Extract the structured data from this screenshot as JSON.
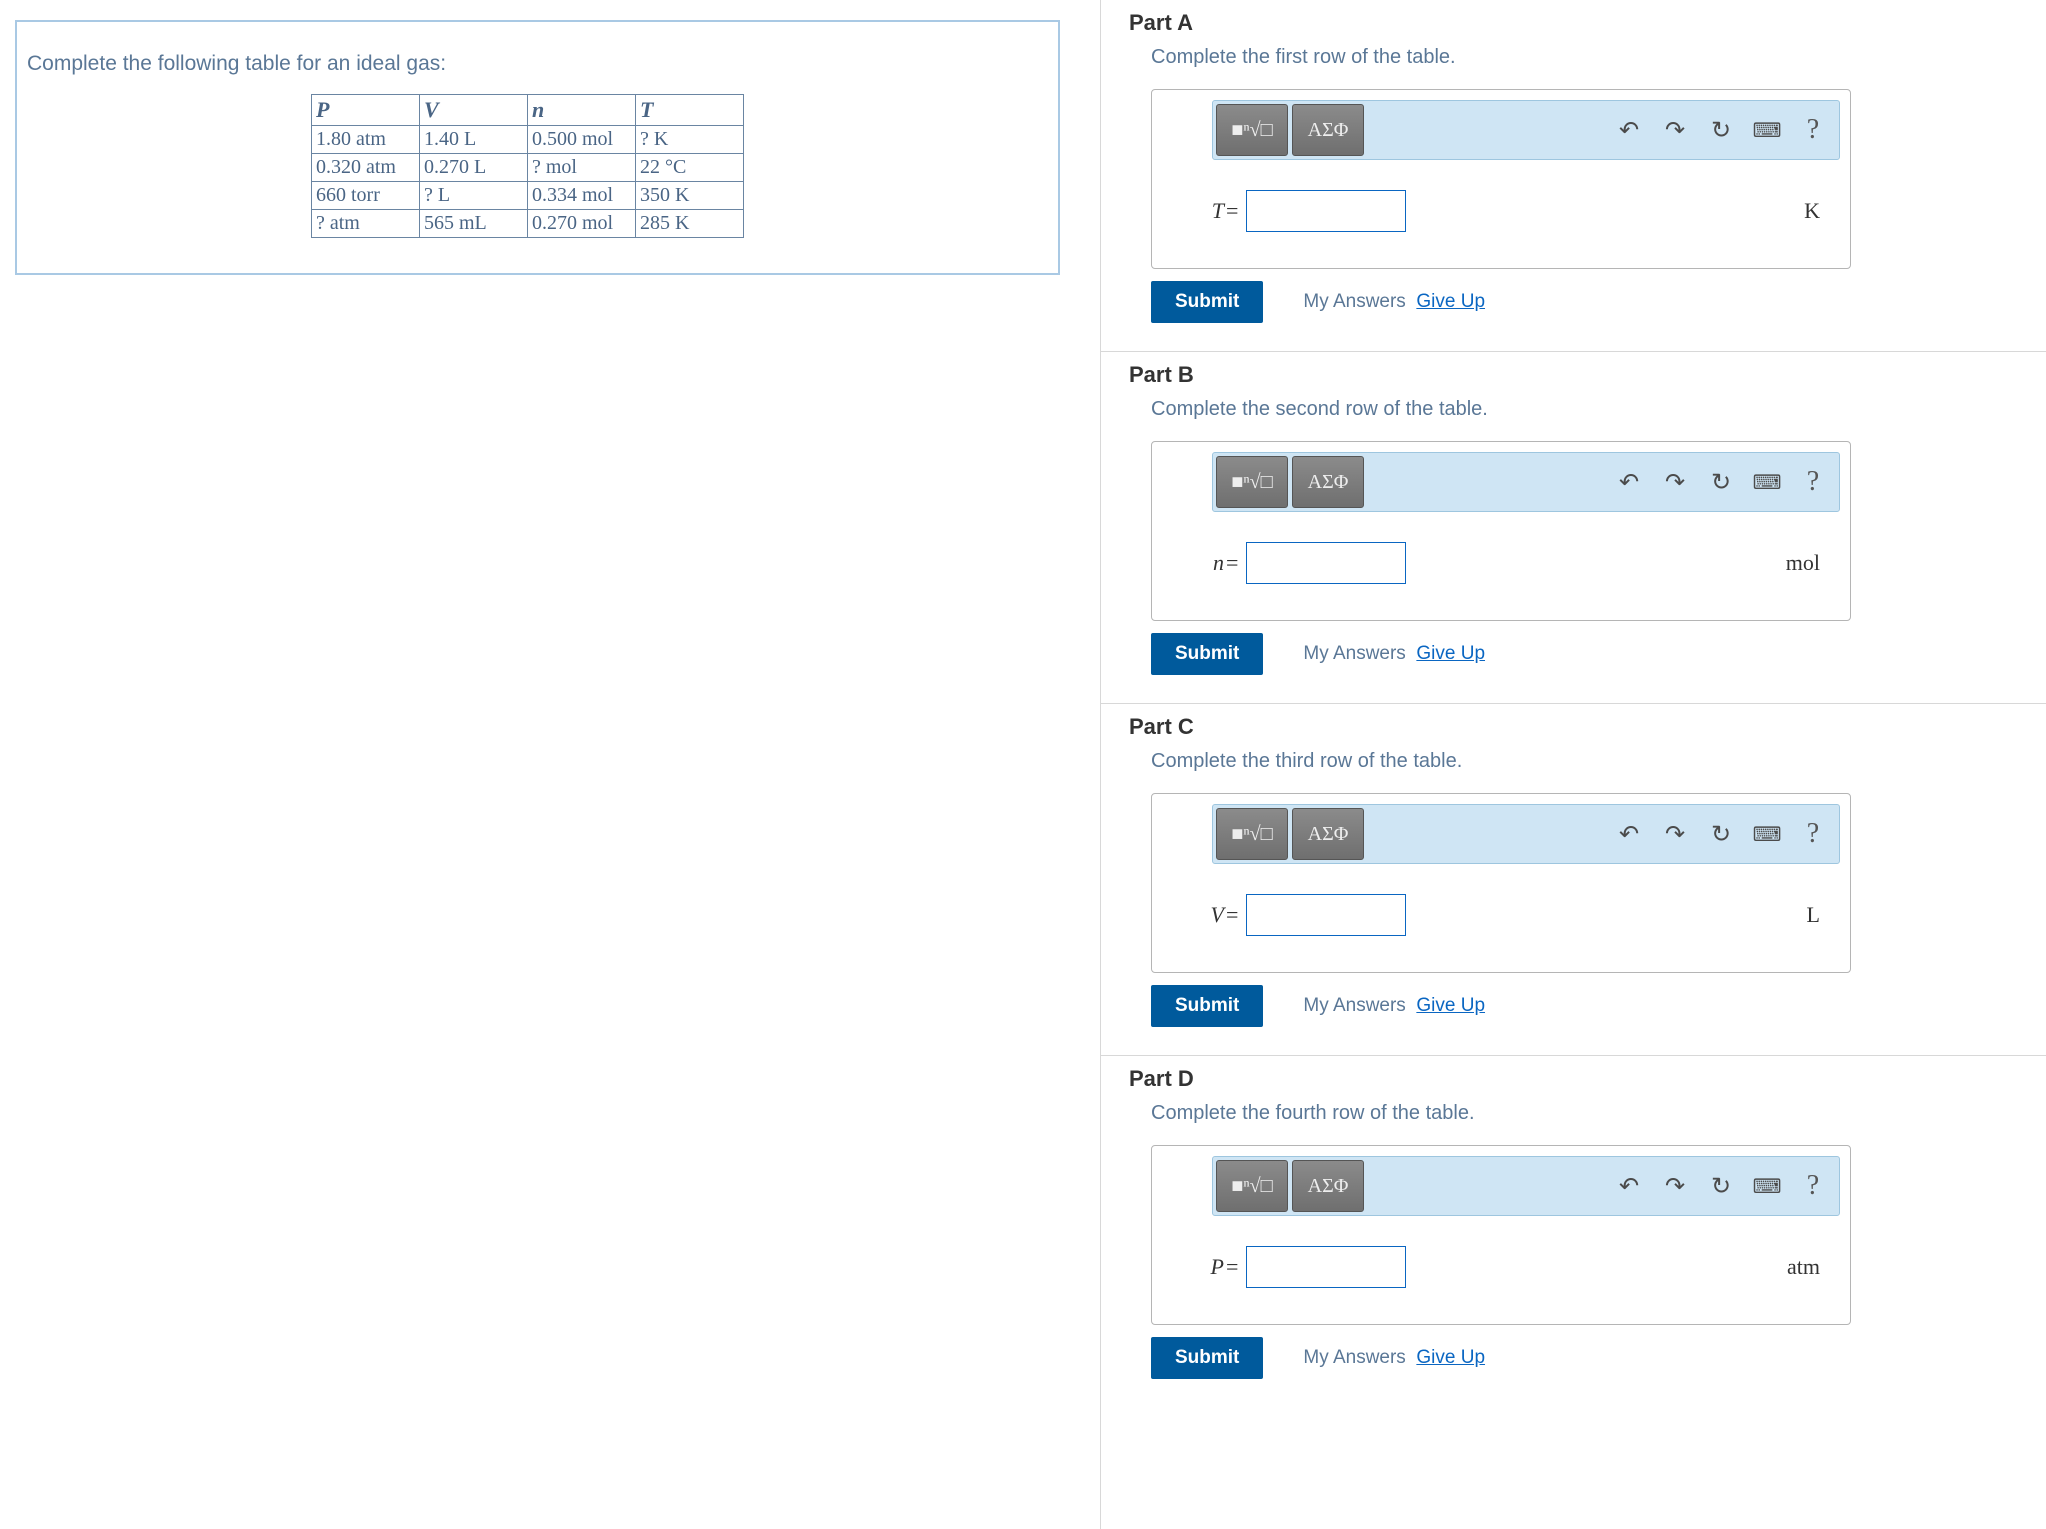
{
  "problem": {
    "prompt": "Complete the following table for an ideal gas:",
    "headers": {
      "P": "P",
      "V": "V",
      "n": "n",
      "T": "T"
    },
    "rows": [
      {
        "P": "1.80 atm",
        "V": "1.40 L",
        "n": "0.500 mol",
        "T": "? K"
      },
      {
        "P": "0.320 atm",
        "V": "0.270 L",
        "n": "? mol",
        "T": "22 °C"
      },
      {
        "P": "660 torr",
        "V": "? L",
        "n": "0.334 mol",
        "T": "350 K"
      },
      {
        "P": "? atm",
        "V": "565 mL",
        "n": "0.270 mol",
        "T": "285 K"
      }
    ]
  },
  "toolbar_labels": {
    "templates": "■ⁿ√□",
    "greek": "ΑΣΦ"
  },
  "actions": {
    "submit": "Submit",
    "my_answers": "My Answers",
    "give_up": "Give Up"
  },
  "parts": [
    {
      "id": "A",
      "title": "Part A",
      "instruction": "Complete the first row of the table.",
      "variable": "T",
      "value": "",
      "unit": "K"
    },
    {
      "id": "B",
      "title": "Part B",
      "instruction": "Complete the second row of the table.",
      "variable": "n",
      "value": "",
      "unit": "mol"
    },
    {
      "id": "C",
      "title": "Part C",
      "instruction": "Complete the third row of the table.",
      "variable": "V",
      "value": "",
      "unit": "L"
    },
    {
      "id": "D",
      "title": "Part D",
      "instruction": "Complete the fourth row of the table.",
      "variable": "P",
      "value": "",
      "unit": "atm"
    }
  ]
}
